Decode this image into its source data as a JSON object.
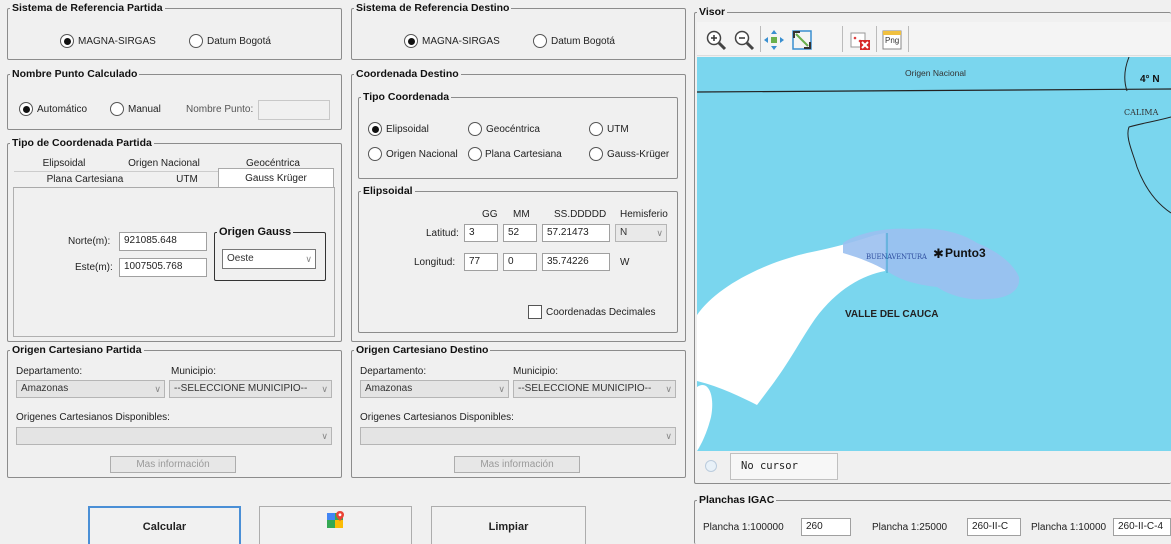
{
  "partida": {
    "title": "Sistema de Referencia Partida",
    "opt1": "MAGNA-SIRGAS",
    "opt2": "Datum Bogotá"
  },
  "destino": {
    "title": "Sistema de Referencia Destino",
    "opt1": "MAGNA-SIRGAS",
    "opt2": "Datum Bogotá"
  },
  "nombre": {
    "title": "Nombre Punto Calculado",
    "auto": "Automático",
    "manual": "Manual",
    "label": "Nombre Punto:",
    "value": ""
  },
  "tipo_partida": {
    "title": "Tipo de Coordenada Partida",
    "tabs_row1": [
      "Elipsoidal",
      "Origen Nacional",
      "Geocéntrica"
    ],
    "tabs_row2": [
      "Plana Cartesiana",
      "UTM",
      "Gauss Krüger"
    ],
    "norte_label": "Norte(m):",
    "norte_value": "921085.648",
    "este_label": "Este(m):",
    "este_value": "1007505.768",
    "origen_gauss_title": "Origen Gauss",
    "origen_gauss_value": "Oeste"
  },
  "coord_destino": {
    "title": "Coordenada Destino",
    "tipo_title": "Tipo Coordenada",
    "opts": [
      "Elipsoidal",
      "Geocéntrica",
      "UTM",
      "Origen Nacional",
      "Plana Cartesiana",
      "Gauss-Krüger"
    ],
    "elip_title": "Elipsoidal",
    "hdr": [
      "GG",
      "MM",
      "SS.DDDDD",
      "Hemisferio"
    ],
    "lat_label": "Latitud:",
    "lat": [
      "3",
      "52",
      "57.21473"
    ],
    "lat_hemi": "N",
    "lon_label": "Longitud:",
    "lon": [
      "77",
      "0",
      "35.74226"
    ],
    "lon_hemi": "W",
    "decimales": "Coordenadas Decimales"
  },
  "cart_partida": {
    "title": "Origen Cartesiano Partida",
    "depto_label": "Departamento:",
    "depto_value": "Amazonas",
    "mun_label": "Municipio:",
    "mun_value": "--SELECCIONE MUNICIPIO--",
    "disp_label": "Origenes Cartesianos Disponibles:",
    "mas_info": "Mas información"
  },
  "cart_destino": {
    "title": "Origen Cartesiano Destino",
    "depto_label": "Departamento:",
    "depto_value": "Amazonas",
    "mun_label": "Municipio:",
    "mun_value": "--SELECCIONE MUNICIPIO--",
    "disp_label": "Origenes Cartesianos Disponibles:",
    "mas_info": "Mas información"
  },
  "buttons": {
    "calcular": "Calcular",
    "limpiar": "Limpiar"
  },
  "visor": {
    "title": "Visor",
    "origen": "Origen Nacional",
    "lat_line": "4° N",
    "calima": "CALIMA",
    "buenaventura": "BUENAVENTURA",
    "punto": "Punto3",
    "valle": "VALLE DEL CAUCA",
    "cursor": "No cursor",
    "png_label": "Png"
  },
  "planchas": {
    "title": "Planchas IGAC",
    "p100_label": "Plancha 1:100000",
    "p100_value": "260",
    "p25_label": "Plancha 1:25000",
    "p25_value": "260-II-C",
    "p10_label": "Plancha 1:10000",
    "p10_value": "260-II-C-4"
  },
  "colors": {
    "sea": "#7ad6ee",
    "lake": "#99bff0",
    "land": "#ffffff",
    "panel": "#f0f0f0"
  }
}
